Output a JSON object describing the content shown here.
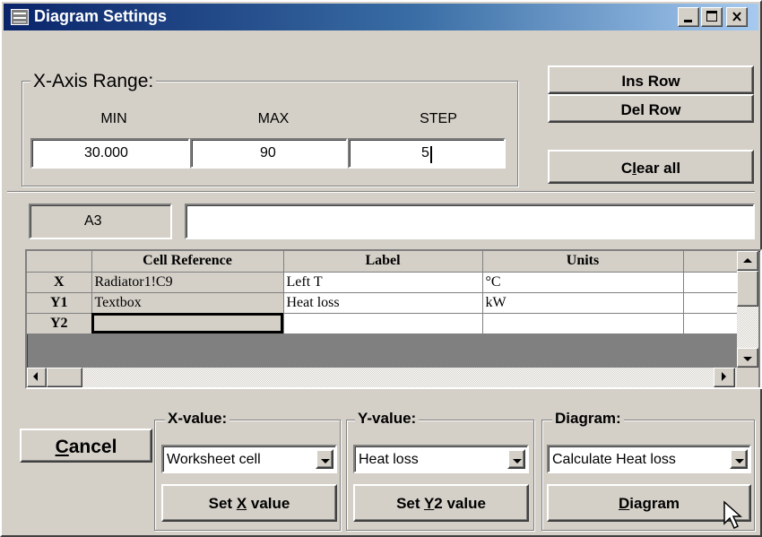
{
  "window": {
    "title": "Diagram Settings",
    "icon": "diagram-app-icon",
    "buttons": {
      "minimize": "minimize-icon",
      "maximize": "maximize-icon",
      "close": "close-icon"
    }
  },
  "x_axis_range": {
    "group_label": "X-Axis Range:",
    "min_label": "MIN",
    "max_label": "MAX",
    "step_label": "STEP",
    "min_value": "30.000",
    "max_value": "90",
    "step_value": "5"
  },
  "side_buttons": {
    "ins_row": "Ins Row",
    "del_row": "Del Row",
    "clear_all_prefix": "C",
    "clear_all_key": "l",
    "clear_all_suffix": "ear all"
  },
  "cell_name": "A3",
  "cell_content": "",
  "grid": {
    "columns": [
      "Cell Reference",
      "Label",
      "Units"
    ],
    "rows": [
      {
        "header": "X",
        "cell_reference": "Radiator1!C9",
        "label": "Left T",
        "units": "°C"
      },
      {
        "header": "Y1",
        "cell_reference": "Textbox",
        "label": "Heat loss",
        "units": "kW"
      },
      {
        "header": "Y2",
        "cell_reference": "",
        "label": "",
        "units": ""
      }
    ]
  },
  "cancel": {
    "key": "C",
    "rest": "ancel"
  },
  "x_value": {
    "group_label": "X-value:",
    "selected": "Worksheet cell",
    "button_prefix": "Set ",
    "button_key": "X",
    "button_suffix": " value"
  },
  "y_value": {
    "group_label": "Y-value:",
    "selected": "Heat loss",
    "button_prefix": "Set ",
    "button_key": "Y",
    "button_suffix": "2 value"
  },
  "diagram": {
    "group_label": "Diagram:",
    "selected": "Calculate Heat loss",
    "button_key": "D",
    "button_suffix": "iagram"
  },
  "colors": {
    "face": "#d4d0c8",
    "title_start": "#0a246a",
    "title_end": "#a6caf0"
  }
}
